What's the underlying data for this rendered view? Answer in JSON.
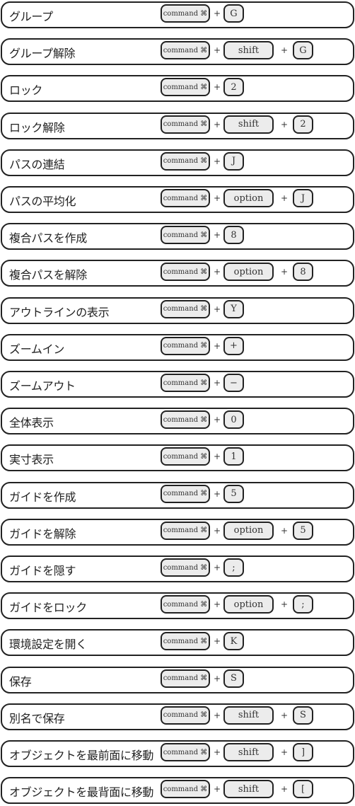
{
  "command_label": "command ⌘",
  "plus": "+",
  "shortcuts": [
    {
      "label": "グループ",
      "keys": [
        "G"
      ]
    },
    {
      "label": "グループ解除",
      "keys": [
        "shift",
        "G"
      ]
    },
    {
      "label": "ロック",
      "keys": [
        "2"
      ]
    },
    {
      "label": "ロック解除",
      "keys": [
        "shift",
        "2"
      ]
    },
    {
      "label": "パスの連結",
      "keys": [
        "J"
      ]
    },
    {
      "label": "パスの平均化",
      "keys": [
        "option",
        "J"
      ]
    },
    {
      "label": "複合パスを作成",
      "keys": [
        "8"
      ]
    },
    {
      "label": "複合パスを解除",
      "keys": [
        "option",
        "8"
      ]
    },
    {
      "label": "アウトラインの表示",
      "keys": [
        "Y"
      ]
    },
    {
      "label": "ズームイン",
      "keys": [
        "+"
      ]
    },
    {
      "label": "ズームアウト",
      "keys": [
        "−"
      ]
    },
    {
      "label": "全体表示",
      "keys": [
        "0"
      ]
    },
    {
      "label": "実寸表示",
      "keys": [
        "1"
      ]
    },
    {
      "label": "ガイドを作成",
      "keys": [
        "5"
      ]
    },
    {
      "label": "ガイドを解除",
      "keys": [
        "option",
        "5"
      ]
    },
    {
      "label": "ガイドを隠す",
      "keys": [
        ";"
      ]
    },
    {
      "label": "ガイドをロック",
      "keys": [
        "option",
        ";"
      ]
    },
    {
      "label": "環境設定を開く",
      "keys": [
        "K"
      ]
    },
    {
      "label": "保存",
      "keys": [
        "S"
      ]
    },
    {
      "label": "別名で保存",
      "keys": [
        "shift",
        "S"
      ]
    },
    {
      "label": "オブジェクトを最前面に移動",
      "keys": [
        "shift",
        "]"
      ]
    },
    {
      "label": "オブジェクトを最背面に移動",
      "keys": [
        "shift",
        "["
      ]
    }
  ]
}
